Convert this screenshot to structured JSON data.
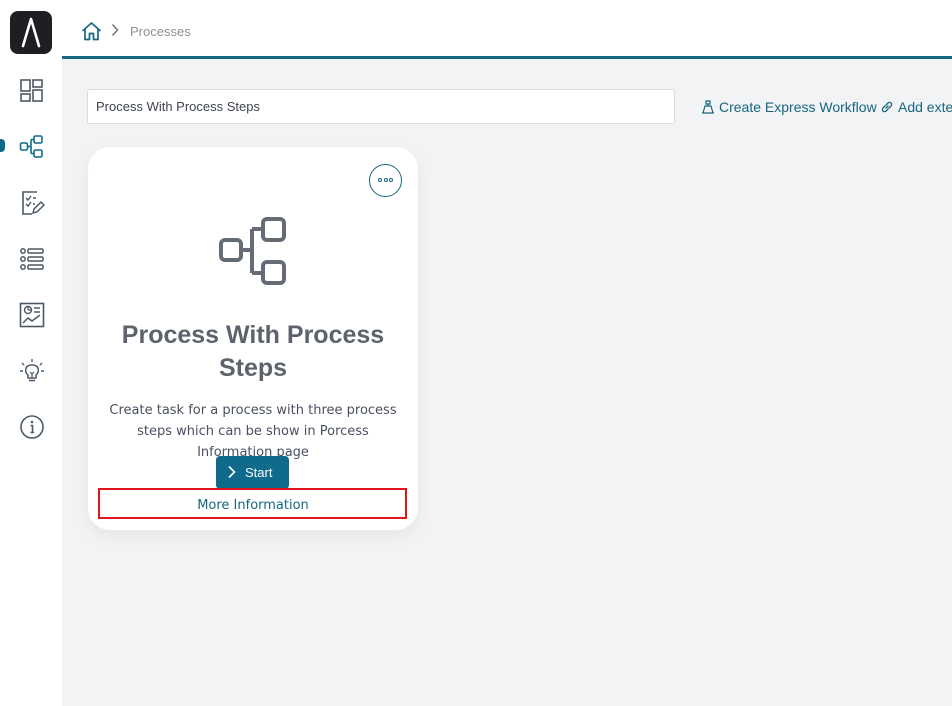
{
  "breadcrumb": {
    "current": "Processes"
  },
  "search": {
    "value": "Process With Process Steps"
  },
  "actions": {
    "create_express_workflow": "Create Express Workflow",
    "add_external": "Add exte"
  },
  "card": {
    "title": "Process With Process Steps",
    "description": "Create task for a process with three process steps which can be show in Porcess Information page",
    "start_label": "Start",
    "more_info_label": "More Information"
  },
  "icons": {
    "sidebar": [
      "dashboard-icon",
      "process-icon",
      "tasks-icon",
      "list-icon",
      "report-icon",
      "idea-icon",
      "info-icon"
    ],
    "topbar": [
      "home-icon",
      "chevron-right-icon"
    ]
  },
  "colors": {
    "accent": "#16677f",
    "primary_button": "#0f6a8b",
    "highlight": "#e0161c",
    "logo_bg": "#1d1f22"
  }
}
